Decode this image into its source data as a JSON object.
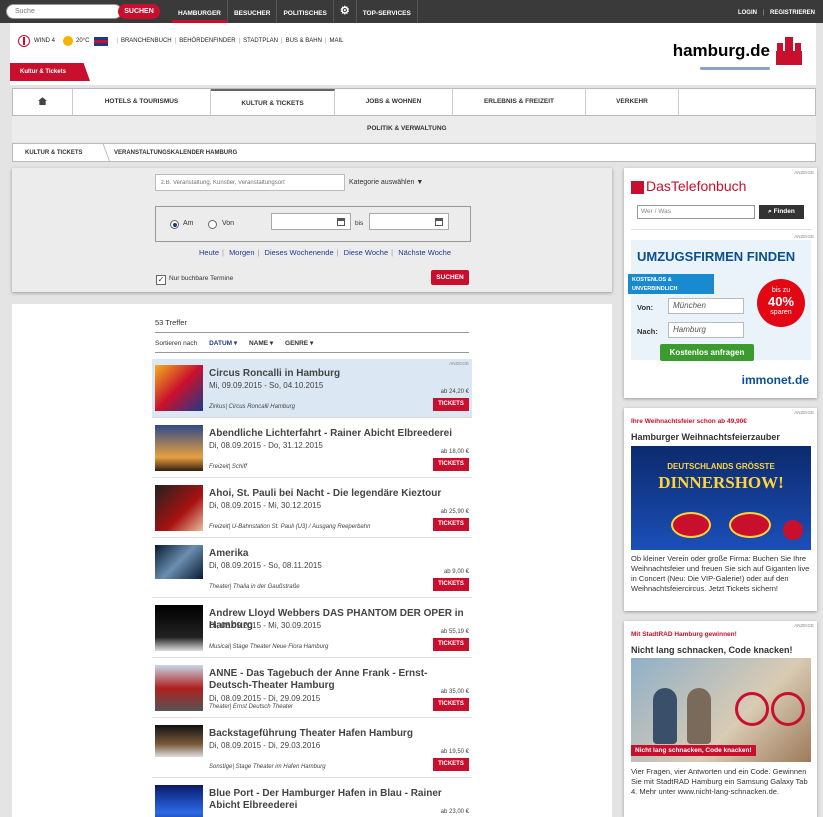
{
  "topbar": {
    "search_placeholder": "Suche",
    "search_button": "SUCHEN",
    "nav": [
      "HAMBURGER",
      "BESUCHER",
      "POLITISCHES",
      "TOP-SERVICES"
    ],
    "login": "LOGIN",
    "register": "REGISTRIEREN"
  },
  "header": {
    "wind": "WIND 4",
    "temp": "20°C",
    "links": [
      "BRANCHENBUCH",
      "BEHÖRDENFINDER",
      "STADTPLAN",
      "BUS & BAHN",
      "MAIL"
    ],
    "logo": "hamburg.de",
    "section_tab": "Kultur & Tickets"
  },
  "mainnav": {
    "items": [
      "HOTELS & TOURISMUS",
      "KULTUR & TICKETS",
      "JOBS & WOHNEN",
      "ERLEBNIS & FREIZEIT",
      "VERKEHR"
    ],
    "sub": "POLITIK & VERWALTUNG"
  },
  "breadcrumb": [
    "KULTUR & TICKETS",
    "VERANSTALTUNGSKALENDER HAMBURG"
  ],
  "filter": {
    "query_placeholder": "z.B. Veranstaltung, Künstler, Veranstaltungsort",
    "category": "Kategorie auswählen",
    "am": "Am",
    "von": "Von",
    "bis": "bis",
    "quick": [
      "Heute",
      "Morgen",
      "Dieses Wochenende",
      "Diese Woche",
      "Nächste Woche"
    ],
    "only_bookable": "Nur buchbare Termine",
    "search": "SUCHEN"
  },
  "results": {
    "count": "53 Treffer",
    "sort_label": "Sortieren nach",
    "sort_options": [
      "DATUM",
      "NAME",
      "GENRE"
    ],
    "ticket_label": "TICKETS",
    "items": [
      {
        "title": "Circus Roncalli in Hamburg",
        "date": "Mi, 09.09.2015 - So, 04.10.2015",
        "category": "Zirkus| Circus Roncalli Hamburg",
        "price": "ab 24,20 €",
        "anzeige": "ANZEIGE"
      },
      {
        "title": "Abendliche Lichterfahrt - Rainer Abicht Elbreederei",
        "date": "Di, 08.09.2015 - Do, 31.12.2015",
        "category": "Freizeit| Schiff",
        "price": "ab 18,00 €"
      },
      {
        "title": "Ahoi, St. Pauli bei Nacht - Die legendäre Kieztour",
        "date": "Di, 08.09.2015 - Mi, 30.12.2015",
        "category": "Freizeit| U-Bahnstation St. Pauli (U3) / Ausgang Reeperbahn",
        "price": "ab 25,90 €"
      },
      {
        "title": "Amerika",
        "date": "Di, 08.09.2015 - So, 08.11.2015",
        "category": "Theater| Thalia in der Gaußstraße",
        "price": "ab 9,00 €"
      },
      {
        "title": "Andrew Lloyd Webbers DAS PHANTOM DER OPER in Hamburg",
        "date": "Di, 08.09.2015 - Mi, 30.09.2015",
        "category": "Musical| Stage Theater Neue Flora Hamburg",
        "price": "ab 55,19 €"
      },
      {
        "title": "ANNE - Das Tagebuch der Anne Frank - Ernst-Deutsch-Theater Hamburg",
        "date": "Di, 08.09.2015 - Di, 29.09.2015",
        "category": "Theater| Ernst Deutsch Theater",
        "price": "ab 35,00 €"
      },
      {
        "title": "Backstageführung Theater Hafen Hamburg",
        "date": "Di, 08.09.2015 - Di, 29.03.2016",
        "category": "Sonstige| Stage Theater im Hafen Hamburg",
        "price": "ab 19,50 €"
      },
      {
        "title": "Blue Port - Der Hamburger Hafen in Blau - Rainer Abicht Elbreederei",
        "date": "",
        "category": "",
        "price": "ab 23,00 €"
      }
    ]
  },
  "sidebar": {
    "anzeige": "ANZEIGE",
    "telefonbuch": "DasTelefonbuch",
    "wer_was": "Wer / Was",
    "finden": "Finden",
    "umzug_title": "UMZUGSFIRMEN FINDEN",
    "kostenlos": "KOSTENLOS & UNVERBINDLICH",
    "bis_zu": "bis zu",
    "percent": "40%",
    "sparen": "sparen",
    "von_label": "Von:",
    "von_value": "München",
    "nach_label": "Nach:",
    "nach_value": "Hamburg",
    "anfragen": "Kostenlos anfragen",
    "immonet": "immonet.de",
    "ad2_small": "Ihre Weihnachtsfeier schon ab 49,90€",
    "ad2_title": "Hamburger Weihnachtsfeierzauber",
    "ad2_banner1": "DEUTSCHLANDS GRÖSSTE",
    "ad2_banner2": "DINNERSHOW!",
    "ad2_text": "Ob kleiner Verein oder große Firma: Buchen Sie Ihre Weihnachtsfeier und freuen Sie sich auf Giganten live in Concert (Neu: Die VIP-Galerie!) oder auf den Weihnachtsfeiercircus. Jetzt Tickets sichern!",
    "ad3_small": "Mit StadtRAD Hamburg gewinnen!",
    "ad3_title": "Nicht lang schnacken, Code knacken!",
    "ad3_caption": "Nicht lang schnacken, Code knacken!",
    "ad3_text": "Vier Fragen, vier Antworten und ein Code. Gewinnen Sie mit StadtRAD Hamburg ein Samsung Galaxy Tab 4. Mehr unter www.nicht-lang-schnacken.de."
  },
  "colors": {
    "accent": "#c8102e",
    "link": "#1d3a8a",
    "topbar": "#3a3a3a"
  }
}
